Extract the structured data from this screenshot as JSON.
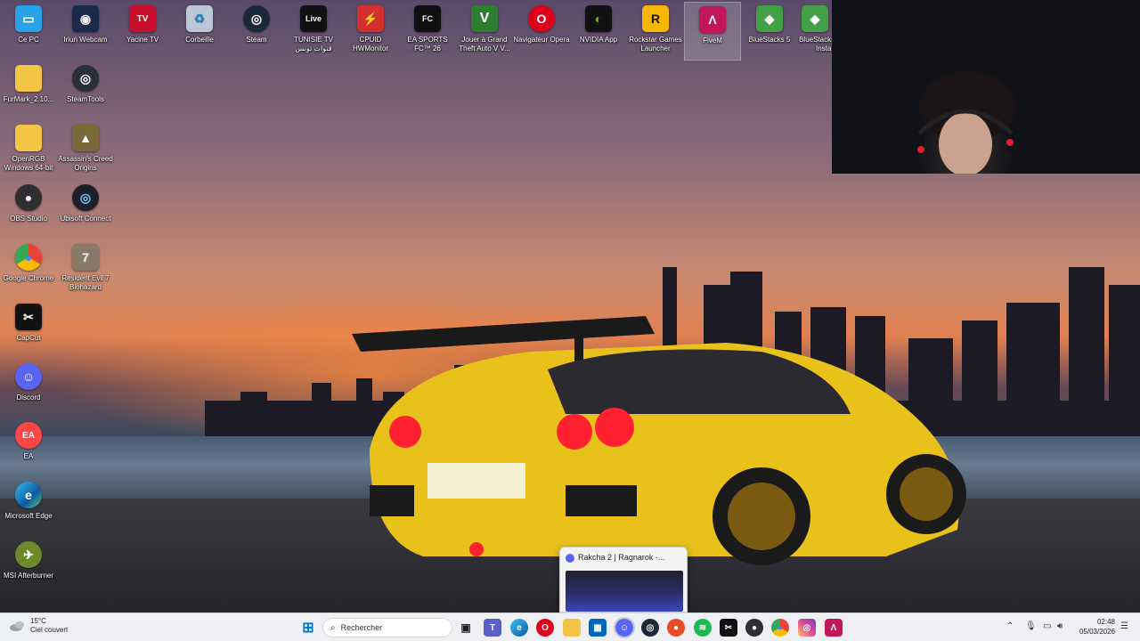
{
  "desktop_icons": [
    {
      "label": "Ce PC",
      "icon": "computer-icon",
      "color": "#29a3e8",
      "glyph": "▭"
    },
    {
      "label": "Iriun Webcam",
      "icon": "webcam-icon",
      "color": "#1a2a4a",
      "glyph": "◉"
    },
    {
      "label": "Yacine TV",
      "icon": "tv-icon",
      "color": "#c8102e",
      "glyph": "TV"
    },
    {
      "label": "Corbeille",
      "icon": "recycle-bin-icon",
      "color": "#b9c7d6",
      "glyph": "♻"
    },
    {
      "label": "Steam",
      "icon": "steam-icon",
      "color": "#1b2838",
      "glyph": "◎"
    },
    {
      "label": "TUNISIE TV قنوات تونس",
      "icon": "live-tv-icon",
      "color": "#111111",
      "glyph": "Live"
    },
    {
      "label": "CPUID HWMonitor",
      "icon": "hwmonitor-icon",
      "color": "#d32f2f",
      "glyph": "⚡"
    },
    {
      "label": "EA SPORTS FC™ 26",
      "icon": "fc26-icon",
      "color": "#101010",
      "glyph": "FC"
    },
    {
      "label": "Jouer à Grand Theft Auto V V...",
      "icon": "gta-icon",
      "color": "#2e7d32",
      "glyph": "V"
    },
    {
      "label": "Navigateur Opera",
      "icon": "opera-icon",
      "color": "#e0001b",
      "glyph": "O"
    },
    {
      "label": "NVIDIA App",
      "icon": "nvidia-icon",
      "color": "#111111",
      "glyph": "◐"
    },
    {
      "label": "Rockstar Games Launcher",
      "icon": "rockstar-icon",
      "color": "#f7b700",
      "glyph": "R"
    },
    {
      "label": "FiveM",
      "icon": "fivem-icon",
      "color": "#c2185b",
      "glyph": "Λ"
    },
    {
      "label": "BlueStacks 5",
      "icon": "bluestacks-icon",
      "color": "#43a047",
      "glyph": "◆"
    },
    {
      "label": "BlueStacks Multi-Insta...",
      "icon": "bluestacks-multi-icon",
      "color": "#43a047",
      "glyph": "◆"
    },
    {
      "label": "FurMark_2.10...",
      "icon": "folder-icon",
      "color": "#f4c542",
      "glyph": ""
    },
    {
      "label": "SteamTools",
      "icon": "steamtools-icon",
      "color": "#2a2f3a",
      "glyph": "◎"
    },
    {
      "label": "OpenRGB Windows 64-bit",
      "icon": "folder-icon",
      "color": "#f4c542",
      "glyph": ""
    },
    {
      "label": "Assassin's Creed Origins",
      "icon": "ac-origins-icon",
      "color": "#7a6a3a",
      "glyph": "▲"
    },
    {
      "label": "OBS Studio",
      "icon": "obs-icon",
      "color": "#302e31",
      "glyph": "●"
    },
    {
      "label": "Ubisoft Connect",
      "icon": "ubisoft-icon",
      "color": "#1d1f2a",
      "glyph": "◎"
    },
    {
      "label": "Google Chrome",
      "icon": "chrome-icon",
      "color": "#4285f4",
      "glyph": "●"
    },
    {
      "label": "Resident Evil 7 Biohazard",
      "icon": "re7-icon",
      "color": "#8a7a6a",
      "glyph": "7"
    },
    {
      "label": "CapCut",
      "icon": "capcut-icon",
      "color": "#111111",
      "glyph": "✂"
    },
    {
      "label": "Discord",
      "icon": "discord-icon",
      "color": "#5865f2",
      "glyph": "☺"
    },
    {
      "label": "EA",
      "icon": "ea-icon",
      "color": "#ff4747",
      "glyph": "EA"
    },
    {
      "label": "Microsoft Edge",
      "icon": "edge-icon",
      "color": "#0c8bd8",
      "glyph": "e"
    },
    {
      "label": "MSI Afterburner",
      "icon": "afterburner-icon",
      "color": "#6d8a2a",
      "glyph": "✈"
    }
  ],
  "preview": {
    "title": "Rakcha 2 | Ragnarok -..."
  },
  "taskbar": {
    "weather_temp": "15°C",
    "weather_desc": "Ciel couvert",
    "search_placeholder": "Rechercher",
    "time": "02:48",
    "date": "05/03/2026"
  }
}
